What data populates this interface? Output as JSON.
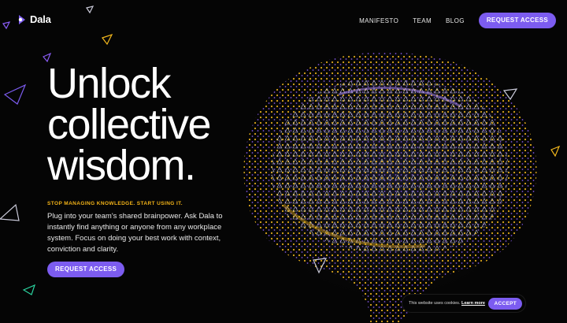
{
  "brand": {
    "name": "Dala",
    "accent": "#7c5cf0",
    "highlight": "#f4b418"
  },
  "nav": {
    "items": [
      "MANIFESTO",
      "TEAM",
      "BLOG"
    ],
    "cta_label": "REQUEST ACCESS"
  },
  "hero": {
    "title_lines": [
      "Unlock",
      "collective",
      "wisdom."
    ],
    "kicker": "STOP MANAGING KNOWLEDGE. START USING IT.",
    "description": "Plug into your team's shared brainpower. Ask Dala to instantly find anything or anyone from any workplace system. Focus on doing your best work with context, conviction and clarity.",
    "cta_label": "REQUEST ACCESS"
  },
  "cookie": {
    "text": "This website uses cookies.",
    "link_label": "Learn more",
    "accept_label": "ACCEPT"
  }
}
